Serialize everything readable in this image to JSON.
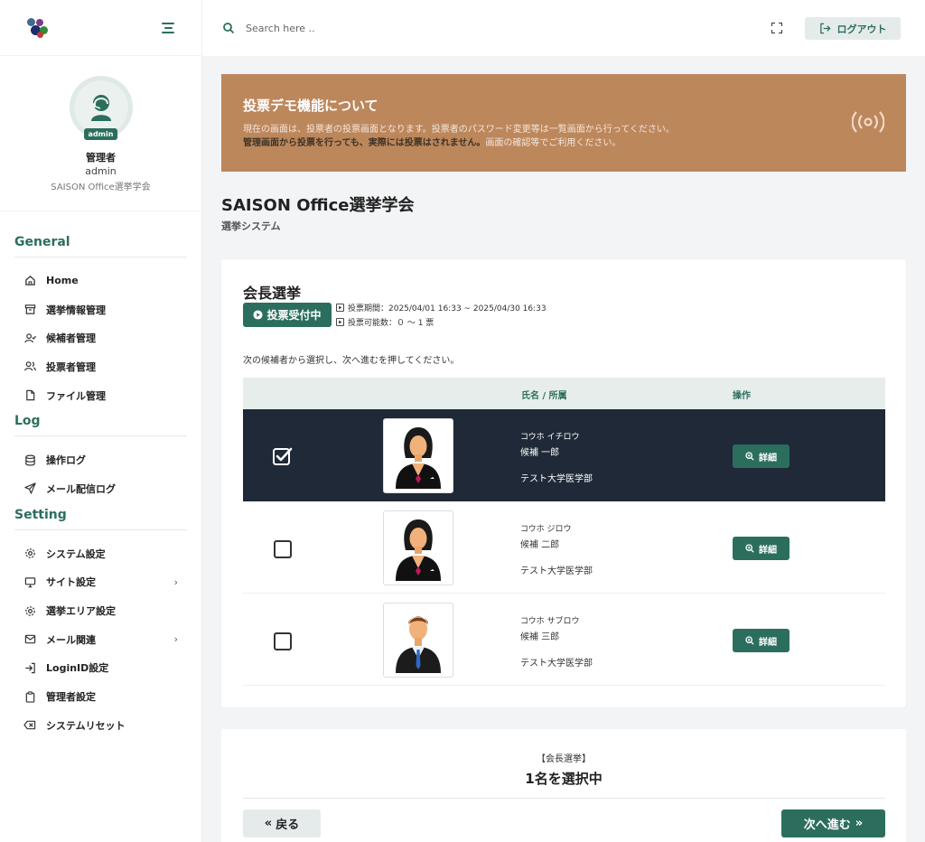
{
  "search": {
    "placeholder": "Search here .."
  },
  "header": {
    "logout_label": "ログアウト"
  },
  "profile": {
    "role": "管理者",
    "user_id": "admin",
    "org": "SAISON Office選挙学会",
    "badge": "admin"
  },
  "sidebar": {
    "sections": [
      {
        "title": "General",
        "items": [
          {
            "label": "Home",
            "icon": "home-icon"
          },
          {
            "label": "選挙情報管理",
            "icon": "archive-icon"
          },
          {
            "label": "候補者管理",
            "icon": "user-check-icon"
          },
          {
            "label": "投票者管理",
            "icon": "users-icon"
          },
          {
            "label": "ファイル管理",
            "icon": "file-icon"
          }
        ]
      },
      {
        "title": "Log",
        "items": [
          {
            "label": "操作ログ",
            "icon": "database-icon"
          },
          {
            "label": "メール配信ログ",
            "icon": "send-icon"
          }
        ]
      },
      {
        "title": "Setting",
        "items": [
          {
            "label": "システム設定",
            "icon": "gear-icon"
          },
          {
            "label": "サイト設定",
            "icon": "monitor-icon",
            "has_submenu": true
          },
          {
            "label": "選挙エリア設定",
            "icon": "gear-icon"
          },
          {
            "label": "メール関連",
            "icon": "mail-icon",
            "has_submenu": true
          },
          {
            "label": "LoginID設定",
            "icon": "login-icon"
          },
          {
            "label": "管理者設定",
            "icon": "clipboard-icon"
          },
          {
            "label": "システムリセット",
            "icon": "delete-icon"
          }
        ]
      }
    ]
  },
  "notice": {
    "title": "投票デモ機能について",
    "line1": "現在の画面は、投票者の投票画面となります。投票者のパスワード変更等は一覧画面から行ってください。",
    "line2_bold": "管理画面から投票を行っても、実際には投票はされません。",
    "line2_rest": "画面の確認等でご利用ください。",
    "accent_color": "#bd875c"
  },
  "page": {
    "title": "SAISON Office選挙学会",
    "subtitle": "選挙システム"
  },
  "election": {
    "title": "会長選挙",
    "status": "投票受付中",
    "period": "投票期間：2025/04/01 16:33 ~ 2025/04/30 16:33",
    "votes_allowed": "投票可能数：０ 〜 1 票",
    "instruction": "次の候補者から選択し、次へ進むを押してください。"
  },
  "table": {
    "headers": {
      "name": "氏名 / 所属",
      "action": "操作"
    },
    "detail_label": "詳細",
    "rows": [
      {
        "kana": "コウホ イチロウ",
        "name": "候補 一郎",
        "org": "テスト大学医学部",
        "selected": true,
        "photo": "female-avatar"
      },
      {
        "kana": "コウホ ジロウ",
        "name": "候補 二郎",
        "org": "テスト大学医学部",
        "selected": false,
        "photo": "female-avatar"
      },
      {
        "kana": "コウホ サブロウ",
        "name": "候補 三郎",
        "org": "テスト大学医学部",
        "selected": false,
        "photo": "male-avatar"
      }
    ]
  },
  "summary": {
    "label": "【会長選挙】",
    "count": "1名を選択中",
    "back_label": "戻る",
    "next_label": "次へ進む"
  },
  "colors": {
    "primary": "#2c6e5d",
    "selected_row": "#1f2937"
  }
}
